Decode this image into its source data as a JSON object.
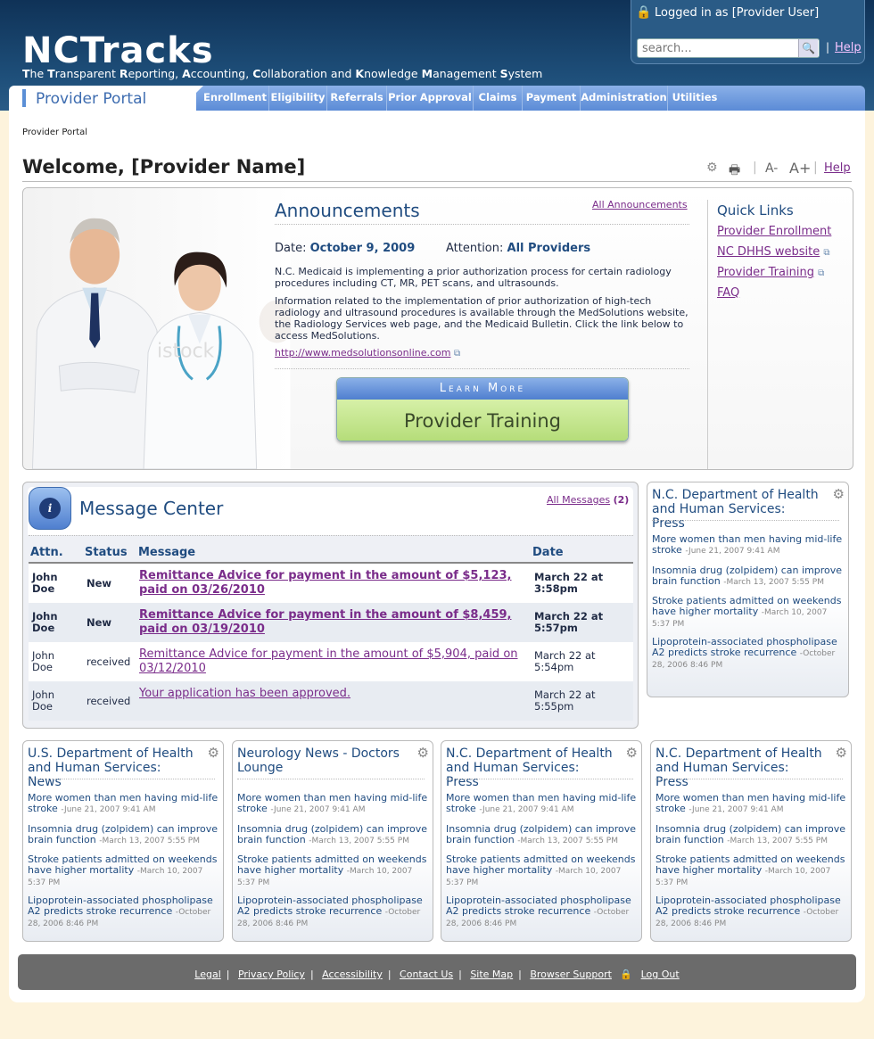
{
  "header": {
    "logo": "NCTracks",
    "tagline_parts": [
      "T",
      "he ",
      "T",
      "ransparent ",
      "R",
      "eporting, ",
      "A",
      "ccounting, ",
      "C",
      "ollaboration and ",
      "K",
      "nowledge ",
      "M",
      "anagement ",
      "S",
      "ystem"
    ],
    "logged_in": "Logged in as [Provider User]",
    "search_placeholder": "search...",
    "help": "Help"
  },
  "nav": {
    "portal": "Provider Portal",
    "items": [
      "Enrollment",
      "Eligibility",
      "Referrals",
      "Prior Approval",
      "Claims",
      "Payment",
      "Administration",
      "Utilities"
    ]
  },
  "breadcrumb": "Provider Portal",
  "welcome": "Welcome, [Provider Name]",
  "tools": {
    "font_smaller": "A-",
    "font_larger": "A+",
    "help": "Help"
  },
  "announcements": {
    "title": "Announcements",
    "all_link": "All Announcements",
    "date_label": "Date:",
    "date": "October 9, 2009",
    "attention_label": "Attention:",
    "attention": "All Providers",
    "p1": "N.C. Medicaid is implementing a prior authorization process for certain radiology procedures including CT, MR, PET scans, and ultrasounds.",
    "p2": "Information related to the implementation of prior authorization of high-tech radiology and ultrasound procedures is available through the MedSolutions website, the Radiology Services web page, and the Medicaid Bulletin. Click the link below to access MedSolutions.",
    "link": "http://www.medsolutionsonline.com",
    "learn_more": "Learn More",
    "training": "Provider Training",
    "watermark": "istock"
  },
  "quick_links": {
    "title": "Quick Links",
    "items": [
      "Provider Enrollment",
      "NC DHHS website",
      "Provider Training",
      "FAQ"
    ]
  },
  "message_center": {
    "title": "Message Center",
    "all_link": "All Messages",
    "count": "(2)",
    "headers": [
      "Attn.",
      "Status",
      "Message",
      "Date"
    ],
    "rows": [
      {
        "attn": "John Doe",
        "status": "New",
        "msg": "Remittance Advice for payment in the amount of $5,123, paid on 03/26/2010",
        "date": "March 22 at 3:58pm",
        "bold": true
      },
      {
        "attn": "John Doe",
        "status": "New",
        "msg": "Remittance Advice for payment in the amount of $8,459, paid on 03/19/2010",
        "date": "March 22 at 5:57pm",
        "bold": true
      },
      {
        "attn": "John Doe",
        "status": "received",
        "msg": "Remittance Advice for payment in the amount of $5,904, paid on 03/12/2010",
        "date": "March 22 at 5:54pm",
        "bold": false
      },
      {
        "attn": "John Doe",
        "status": "received",
        "msg": "Your application has been approved.",
        "date": "March 22 at 5:55pm",
        "bold": false
      }
    ]
  },
  "news_items": [
    {
      "title": "More women than men having mid-life stroke",
      "date": "-June 21, 2007 9:41 AM"
    },
    {
      "title": "Insomnia drug (zolpidem) can improve brain function",
      "date": "-March 13, 2007 5:55 PM"
    },
    {
      "title": "Stroke patients admitted on weekends have higher mortality",
      "date": "-March 10, 2007 5:37 PM"
    },
    {
      "title": "Lipoprotein-associated phospholipase A2 predicts stroke recurrence",
      "date": "-October 28, 2006 8:46 PM"
    }
  ],
  "news_boxes": [
    "N.C. Department of Health and Human Services: Press",
    "U.S. Department of Health and Human Services: News",
    "Neurology News - Doctors Lounge",
    "N.C. Department of Health and Human Services: Press",
    "N.C. Department of Health and Human Services: Press"
  ],
  "footer": [
    "Legal",
    "Privacy Policy",
    "Accessibility",
    "Contact Us",
    "Site Map",
    "Browser Support",
    "Log Out"
  ]
}
